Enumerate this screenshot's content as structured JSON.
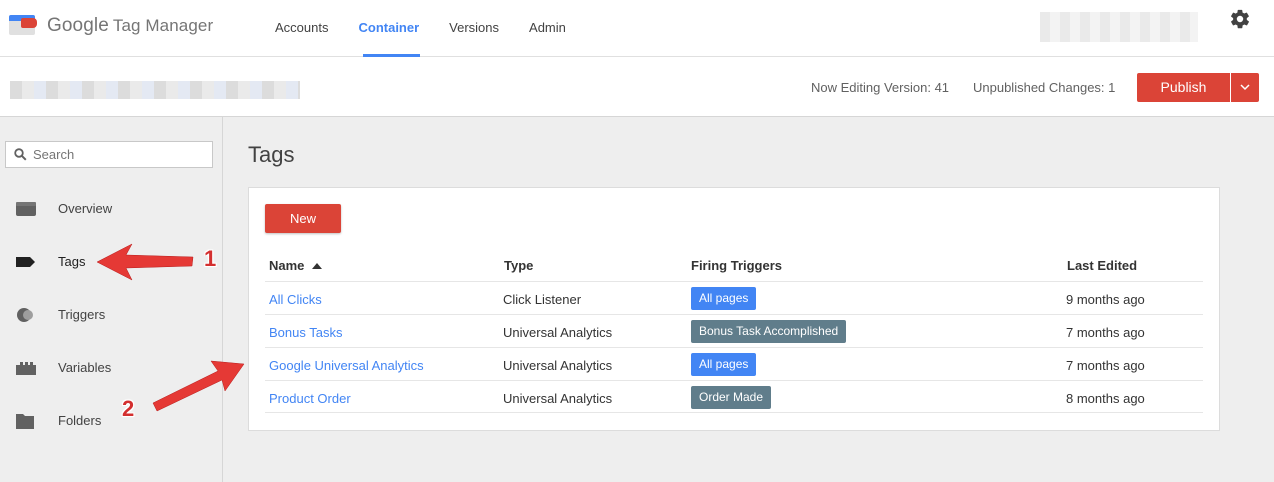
{
  "header": {
    "logo_google": "Google",
    "logo_product": "Tag Manager",
    "nav": [
      {
        "label": "Accounts",
        "active": false
      },
      {
        "label": "Container",
        "active": true
      },
      {
        "label": "Versions",
        "active": false
      },
      {
        "label": "Admin",
        "active": false
      }
    ],
    "settings_icon": "gear-icon"
  },
  "subbar": {
    "editing_version": "Now Editing Version: 41",
    "unpublished_changes": "Unpublished Changes: 1",
    "publish_label": "Publish",
    "publish_dropdown_icon": "chevron-down-icon"
  },
  "sidebar": {
    "search_placeholder": "Search",
    "items": [
      {
        "label": "Overview",
        "icon": "overview-icon"
      },
      {
        "label": "Tags",
        "icon": "tag-icon"
      },
      {
        "label": "Triggers",
        "icon": "trigger-icon"
      },
      {
        "label": "Variables",
        "icon": "variable-icon"
      },
      {
        "label": "Folders",
        "icon": "folder-icon"
      }
    ]
  },
  "main": {
    "title": "Tags",
    "new_label": "New",
    "columns": {
      "name": "Name",
      "type": "Type",
      "triggers": "Firing Triggers",
      "edited": "Last Edited"
    },
    "rows": [
      {
        "name": "All Clicks",
        "type": "Click Listener",
        "trigger": "All pages",
        "edited": "9 months ago"
      },
      {
        "name": "Bonus Tasks",
        "type": "Universal Analytics",
        "trigger": "Bonus Task Accomplished",
        "edited": "7 months ago"
      },
      {
        "name": "Google Universal Analytics",
        "type": "Universal Analytics",
        "trigger": "All pages",
        "edited": "7 months ago"
      },
      {
        "name": "Product Order",
        "type": "Universal Analytics",
        "trigger": "Order Made",
        "edited": "8 months ago"
      }
    ]
  },
  "annotations": [
    "1",
    "2"
  ],
  "colors": {
    "accent_blue": "#4285f4",
    "publish_red": "#db4437",
    "chip_blue": "#4285f4",
    "chip_gray": "#607d8b",
    "annotation_red": "#d32f2f"
  }
}
